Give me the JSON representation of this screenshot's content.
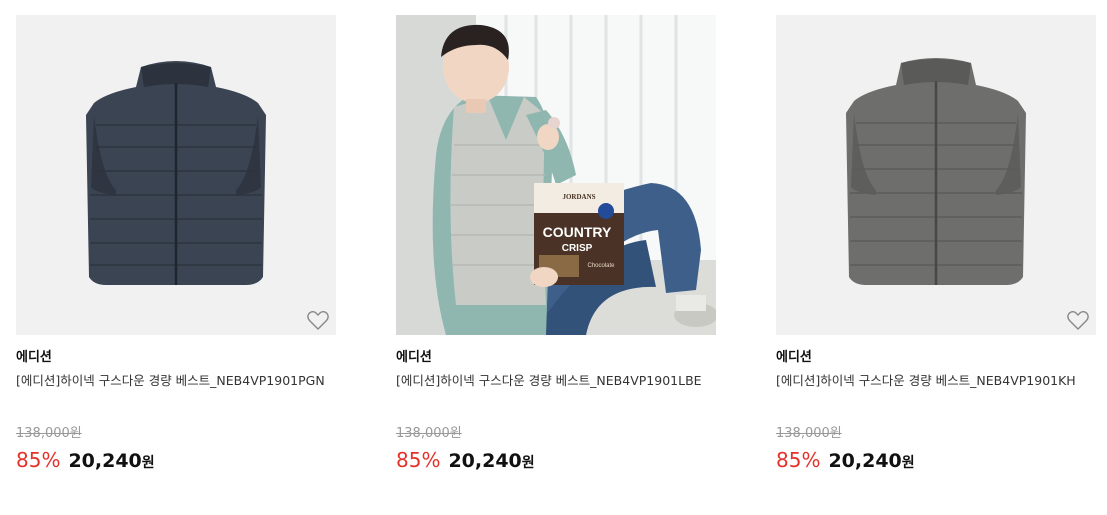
{
  "products": [
    {
      "brand": "에디션",
      "name": "[에디션]하이넥 구스다운 경량 베스트_NEB4VP1901PGN",
      "original_price": "138,000원",
      "discount": "85%",
      "sale_price": "20,240",
      "currency": "원",
      "image": "navy-vest",
      "color": "#3b4452"
    },
    {
      "brand": "에디션",
      "name": "[에디션]하이넥 구스다운 경량 베스트_NEB4VP1901LBE",
      "original_price": "138,000원",
      "discount": "85%",
      "sale_price": "20,240",
      "currency": "원",
      "image": "model-photo",
      "color": "#c9cbc6",
      "cereal_box": {
        "brand": "JORDANS",
        "line1": "COUNTRY",
        "line2": "CRISP",
        "flavor": "Chocolate"
      }
    },
    {
      "brand": "에디션",
      "name": "[에디션]하이넥 구스다운 경량 베스트_NEB4VP1901KH",
      "original_price": "138,000원",
      "discount": "85%",
      "sale_price": "20,240",
      "currency": "원",
      "image": "grey-vest",
      "color": "#6e6e6c"
    }
  ],
  "icons": {
    "wishlist": "heart-icon"
  },
  "colors": {
    "discount": "#e4322b",
    "original_price": "#999999"
  }
}
